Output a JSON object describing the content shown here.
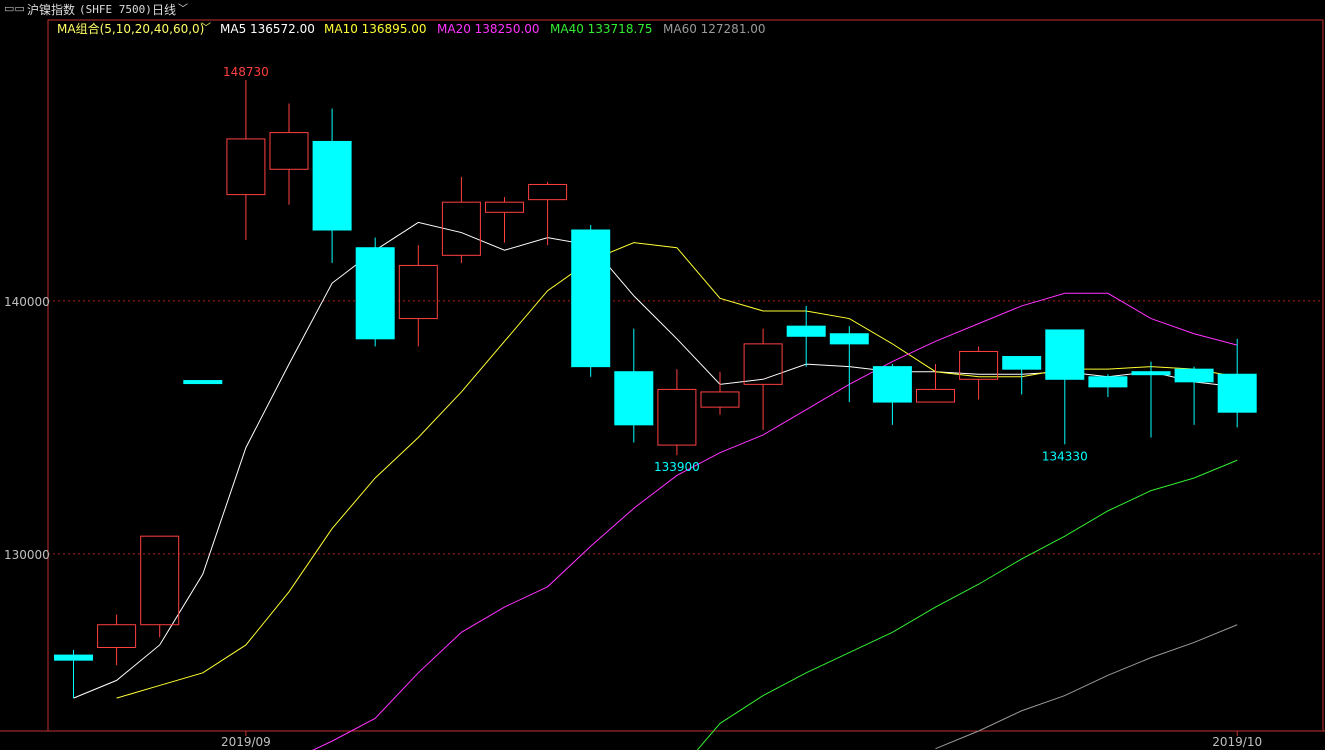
{
  "header": {
    "icon": "window-icon",
    "title": "沪镍指数",
    "code": "(SHFE 7500)",
    "period": "日线",
    "period_dropdown_icon": "chevron-down-icon"
  },
  "legend": {
    "combo_label": "MA组合(5,10,20,40,60,0)",
    "combo_dropdown_icon": "chevron-down-icon",
    "items": [
      {
        "label": "MA5 136572.00",
        "color": "#ffffff"
      },
      {
        "label": "MA10 136895.00",
        "color": "#ffff33"
      },
      {
        "label": "MA20 138250.00",
        "color": "#ff33ff"
      },
      {
        "label": "MA40 133718.75",
        "color": "#33ee33"
      },
      {
        "label": "MA60 127281.00",
        "color": "#9a9a9a"
      }
    ]
  },
  "colors": {
    "up": "#ff4040",
    "down": "#00ffff",
    "background": "#000000",
    "frame": "#c03030",
    "grid": "#b02020",
    "axis_text": "#c0c0c0"
  },
  "chart_data": {
    "type": "candlestick",
    "ylim": [
      123000,
      151100
    ],
    "y_ticks": [
      "140000",
      "130000"
    ],
    "x_tick_labels": [
      "2019/09",
      "2019/10"
    ],
    "candles": [
      {
        "open": 126000,
        "close": 125800,
        "high": 126200,
        "low": 124300,
        "dir": "down"
      },
      {
        "open": 126300,
        "close": 127200,
        "high": 127600,
        "low": 125600,
        "dir": "up"
      },
      {
        "open": 127200,
        "close": 130700,
        "high": 130700,
        "low": 126700,
        "dir": "up"
      },
      {
        "open": 136850,
        "close": 136750,
        "high": 136850,
        "low": 136750,
        "dir": "down"
      },
      {
        "open": 144200,
        "close": 146400,
        "high": 148730,
        "low": 142400,
        "dir": "up"
      },
      {
        "open": 145200,
        "close": 146650,
        "high": 147800,
        "low": 143800,
        "dir": "up"
      },
      {
        "open": 146300,
        "close": 142800,
        "high": 147600,
        "low": 141500,
        "dir": "down"
      },
      {
        "open": 142100,
        "close": 138500,
        "high": 142500,
        "low": 138200,
        "dir": "down"
      },
      {
        "open": 139300,
        "close": 141400,
        "high": 142200,
        "low": 138200,
        "dir": "up"
      },
      {
        "open": 141800,
        "close": 143900,
        "high": 144900,
        "low": 141500,
        "dir": "up"
      },
      {
        "open": 143500,
        "close": 143900,
        "high": 144100,
        "low": 142300,
        "dir": "up"
      },
      {
        "open": 144000,
        "close": 144600,
        "high": 144700,
        "low": 142200,
        "dir": "up"
      },
      {
        "open": 142800,
        "close": 137400,
        "high": 143000,
        "low": 137000,
        "dir": "down"
      },
      {
        "open": 137200,
        "close": 135100,
        "high": 138900,
        "low": 134400,
        "dir": "down"
      },
      {
        "open": 134300,
        "close": 136500,
        "high": 137300,
        "low": 133900,
        "dir": "up"
      },
      {
        "open": 135800,
        "close": 136400,
        "high": 137200,
        "low": 135500,
        "dir": "up"
      },
      {
        "open": 136700,
        "close": 138300,
        "high": 138900,
        "low": 134900,
        "dir": "up"
      },
      {
        "open": 139000,
        "close": 138600,
        "high": 139800,
        "low": 137400,
        "dir": "down"
      },
      {
        "open": 138700,
        "close": 138300,
        "high": 139000,
        "low": 136000,
        "dir": "down"
      },
      {
        "open": 137400,
        "close": 136000,
        "high": 137500,
        "low": 135100,
        "dir": "down"
      },
      {
        "open": 136000,
        "close": 136500,
        "high": 137500,
        "low": 136000,
        "dir": "up"
      },
      {
        "open": 136900,
        "close": 138000,
        "high": 138200,
        "low": 136100,
        "dir": "up"
      },
      {
        "open": 137800,
        "close": 137300,
        "high": 137800,
        "low": 136300,
        "dir": "down"
      },
      {
        "open": 138850,
        "close": 136900,
        "high": 138850,
        "low": 134330,
        "dir": "down"
      },
      {
        "open": 137000,
        "close": 136600,
        "high": 137100,
        "low": 136200,
        "dir": "down"
      },
      {
        "open": 137200,
        "close": 137100,
        "high": 137600,
        "low": 134600,
        "dir": "down"
      },
      {
        "open": 137300,
        "close": 136800,
        "high": 137400,
        "low": 135100,
        "dir": "down"
      },
      {
        "open": 137100,
        "close": 135600,
        "high": 138500,
        "low": 135000,
        "dir": "down"
      }
    ],
    "annotations": [
      {
        "label": "148730",
        "index": 4,
        "value": 148730,
        "color": "#ff4040",
        "position": "above"
      },
      {
        "label": "133900",
        "index": 14,
        "value": 133900,
        "color": "#00ffff",
        "position": "below"
      },
      {
        "label": "134330",
        "index": 23,
        "value": 134330,
        "color": "#00ffff",
        "position": "below"
      }
    ],
    "series": [
      {
        "name": "MA5",
        "color": "#ffffff",
        "values": [
          124300,
          125000,
          126400,
          129200,
          134200,
          137500,
          140700,
          142000,
          143100,
          142700,
          142000,
          142500,
          142200,
          140200,
          138500,
          136700,
          136900,
          137500,
          137400,
          137200,
          137200,
          137100,
          137100,
          137200,
          137000,
          137200,
          136800,
          136600
        ]
      },
      {
        "name": "MA10",
        "color": "#ffff33",
        "values": [
          124300,
          124800,
          125300,
          126400,
          128500,
          131000,
          133000,
          134600,
          136400,
          138400,
          140400,
          141600,
          142300,
          142100,
          140100,
          139600,
          139600,
          139300,
          138300,
          137200,
          137000,
          137000,
          137300,
          137300,
          137400,
          137300,
          137000
        ]
      },
      {
        "name": "MA20",
        "color": "#ff33ff",
        "values": [
          121800,
          122600,
          123500,
          125300,
          126900,
          127900,
          128700,
          130300,
          131800,
          133100,
          134000,
          134700,
          135700,
          136700,
          137600,
          138400,
          139100,
          139800,
          140300,
          140300,
          139300,
          138700,
          138250
        ]
      },
      {
        "name": "MA40",
        "color": "#33ee33",
        "values": [
          121300,
          123300,
          124400,
          125300,
          126100,
          126900,
          127900,
          128800,
          129800,
          130700,
          131700,
          132500,
          133000,
          133700
        ]
      },
      {
        "name": "MA60",
        "color": "#9a9a9a",
        "values": [
          122300,
          123000,
          123800,
          124400,
          125200,
          125900,
          126500,
          127200
        ]
      }
    ]
  }
}
